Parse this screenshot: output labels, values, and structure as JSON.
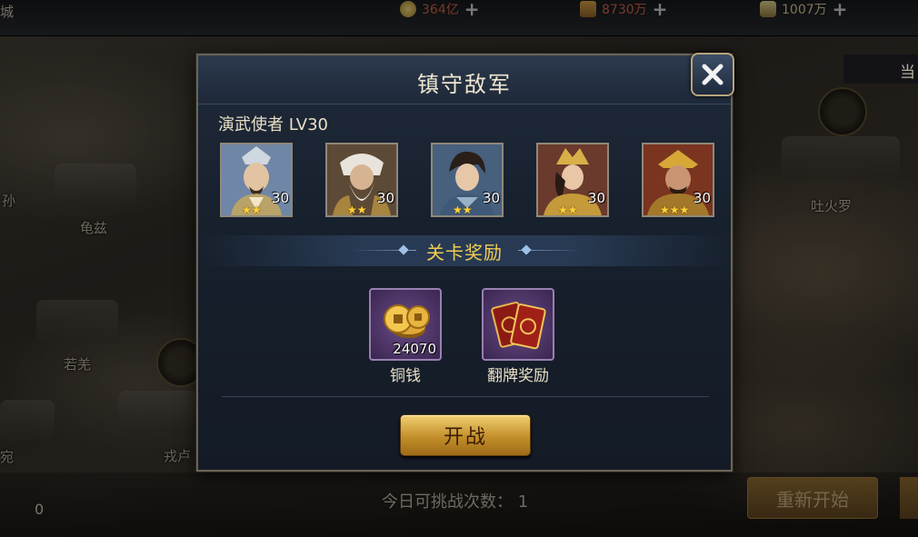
{
  "top_bar": {
    "left_text": "城",
    "resources": [
      {
        "icon": "copper-coin-icon",
        "value": "364亿"
      },
      {
        "icon": "food-icon",
        "value": "8730万"
      },
      {
        "icon": "silver-ingot-icon",
        "value": "1007万"
      }
    ],
    "plus": "+"
  },
  "map": {
    "cities": [
      "孙",
      "龟兹",
      "若羌",
      "戎卢",
      "吐火罗",
      "宛"
    ],
    "side_tab_label": "当"
  },
  "dialog": {
    "title": "镇守敌军",
    "enemy_name": "演武使者  LV30",
    "heroes": [
      {
        "level": "30",
        "stars": 2,
        "star_text": "★★"
      },
      {
        "level": "30",
        "stars": 2,
        "star_text": "★★"
      },
      {
        "level": "30",
        "stars": 2,
        "star_text": "★★"
      },
      {
        "level": "30",
        "stars": 2,
        "star_text": "★★"
      },
      {
        "level": "30",
        "stars": 3,
        "star_text": "★★★"
      }
    ],
    "rewards_title": "关卡奖励",
    "rewards": [
      {
        "icon": "copper-coins-icon",
        "count": "24070",
        "label": "铜钱"
      },
      {
        "icon": "flip-cards-icon",
        "count": "",
        "label": "翻牌奖励"
      }
    ],
    "battle_button": "开战"
  },
  "bottom": {
    "daily_challenges": "今日可挑战次数： 1",
    "left_count": "0",
    "restart_button": "重新开始"
  },
  "colors": {
    "title_text": "#efe6cf",
    "rewards_title": "#f2cc54",
    "star": "#ffd23c",
    "battle_button": "#c38f2a",
    "dialog_bg": "#17202d"
  }
}
